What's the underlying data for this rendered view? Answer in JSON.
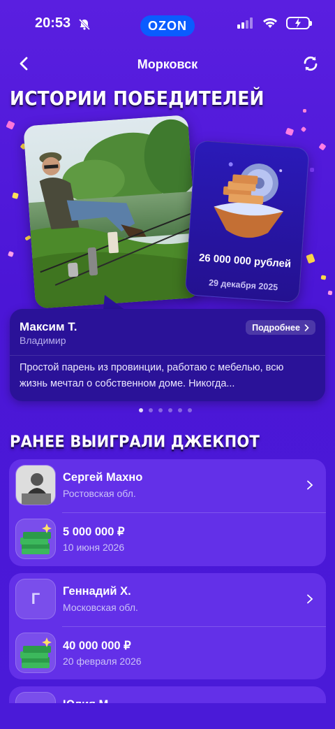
{
  "status_bar": {
    "time": "20:53",
    "brand": "OZON"
  },
  "header": {
    "title": "Морковск"
  },
  "stories": {
    "section_title": "ИСТОРИИ ПОБЕДИТЕЛЕЙ",
    "prize": {
      "amount": "26 000 000 рублей",
      "date": "29 декабря 2025"
    },
    "winner": {
      "name": "Максим Т.",
      "city": "Владимир",
      "more_label": "Подробнее",
      "text": "Простой парень из провинции, работаю с мебелью, всю жизнь мечтал о собственном доме. Никогда..."
    },
    "pager": {
      "count": 6,
      "active_index": 0
    }
  },
  "jackpots": {
    "section_title": "РАНЕЕ ВЫИГРАЛИ ДЖЕКПОТ",
    "items": [
      {
        "name": "Сергей Махно",
        "region": "Ростовская обл.",
        "amount": "5 000 000 ₽",
        "date": "10 июня 2026",
        "initial": ""
      },
      {
        "name": "Геннадий Х.",
        "region": "Московская обл.",
        "amount": "40 000 000 ₽",
        "date": "20 февраля 2026",
        "initial": "Г"
      },
      {
        "name": "Юлия М.",
        "region": "",
        "amount": "",
        "date": "",
        "initial": ""
      }
    ]
  },
  "colors": {
    "accent": "#0a5cff",
    "background": "#4b16d6",
    "card": "#6330e8",
    "story_card": "#2a1298"
  },
  "icons": {
    "back": "chevron-left-icon",
    "refresh": "refresh-icon",
    "bell_muted": "bell-muted-icon",
    "signal": "signal-icon",
    "wifi": "wifi-icon",
    "battery": "battery-charging-icon",
    "chevron_right": "chevron-right-icon",
    "money": "money-stack-icon"
  }
}
